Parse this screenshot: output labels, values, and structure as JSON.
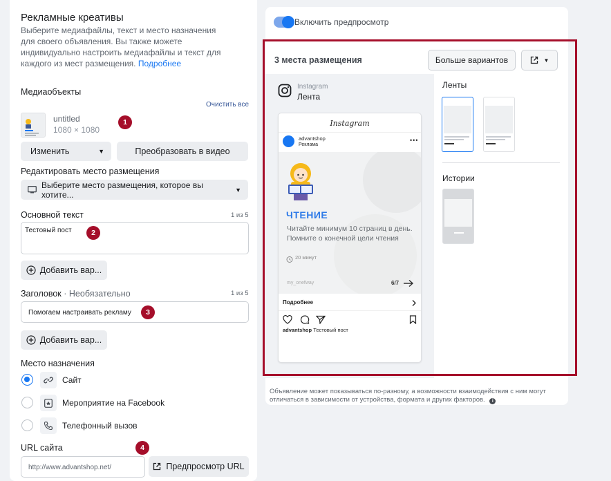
{
  "left": {
    "title": "Рекламные креативы",
    "description": "Выберите медиафайлы, текст и место назначения для своего объявления. Вы также можете индивидуально настроить медиафайлы и текст для каждого из мест размещения.",
    "more_link": "Подробнее",
    "media_label": "Медиаобъекты",
    "clear_all": "Очистить все",
    "file_name": "untitled",
    "file_size": "1080 × 1080",
    "change_btn": "Изменить",
    "convert_btn": "Преобразовать в видео",
    "edit_placement_label": "Редактировать место размещения",
    "placement_select": "Выберите место размещения, которое вы хотите...",
    "primary_text_label": "Основной текст",
    "primary_text_counter": "1 из 5",
    "primary_text_value": "Тестовый пост",
    "add_variant_1": "Добавить вар...",
    "headline_label": "Заголовок",
    "headline_optional": " · Необязательно",
    "headline_counter": "1 из 5",
    "headline_value": "Помогаем настраивать рекламу",
    "add_variant_2": "Добавить вар...",
    "destination_label": "Место назначения",
    "dest_options": [
      "Сайт",
      "Мероприятие на Facebook",
      "Телефонный вызов"
    ],
    "url_label": "URL сайта",
    "url_value": "http://www.advantshop.net/",
    "preview_url_btn": "Предпросмотр URL",
    "badges": [
      "1",
      "2",
      "3",
      "4"
    ]
  },
  "right": {
    "toggle_label": "Включить предпросмотр",
    "placements_title": "3 места размещения",
    "more_options_btn": "Больше вариантов",
    "platform": "Instagram",
    "placement_name": "Лента",
    "feeds_label": "Ленты",
    "stories_label": "Истории",
    "disclaimer": "Объявление может показываться по-разному, а возможности взаимодействия с ним могут отличаться в зависимости от устройства, формата и других факторов."
  },
  "post": {
    "app_header": "Instagram",
    "account": "advantshop",
    "sponsored": "Реклама",
    "heading": "ЧТЕНИЕ",
    "body": "Читайте минимум 10 страниц в день. Помните о конечной цели чтения",
    "time": "20 минут",
    "handle": "my_onefway",
    "page_count": "6/7",
    "cta": "Подробнее",
    "caption_account": "advantshop",
    "caption_text": "Тестовый пост"
  },
  "colors": {
    "accent": "#1877f2",
    "badge": "#a50e2a",
    "highlight_frame": "#a50e2a"
  }
}
